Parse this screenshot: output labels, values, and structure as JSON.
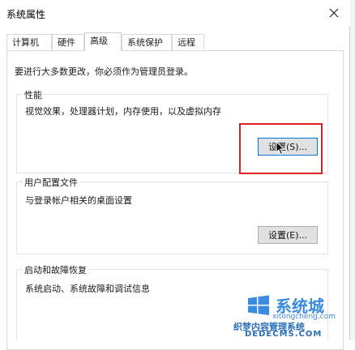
{
  "window": {
    "title": "系统属性"
  },
  "tabs": [
    {
      "label": "计算机名",
      "active": false
    },
    {
      "label": "硬件",
      "active": false
    },
    {
      "label": "高级",
      "active": true
    },
    {
      "label": "系统保护",
      "active": false
    },
    {
      "label": "远程",
      "active": false
    }
  ],
  "notice": "要进行大多数更改，你必须作为管理员登录。",
  "performance": {
    "title": "性能",
    "desc": "视觉效果，处理器计划，内存使用，以及虚拟内存",
    "button": "设置(S)..."
  },
  "user_profiles": {
    "title": "用户配置文件",
    "desc": "与登录帐户相关的桌面设置",
    "button": "设置(E)..."
  },
  "startup_recovery": {
    "title": "启动和故障恢复",
    "desc": "系统启动、系统故障和调试信息"
  },
  "watermark": {
    "brand": "系统城",
    "site": "xitongcheng.com",
    "overlay_cn": "织梦内容管理系统",
    "overlay_en": "DEDECMS.COM"
  },
  "colors": {
    "accent": "#0078d7",
    "highlight": "#e32020",
    "button_bg": "#e1e1e1"
  }
}
